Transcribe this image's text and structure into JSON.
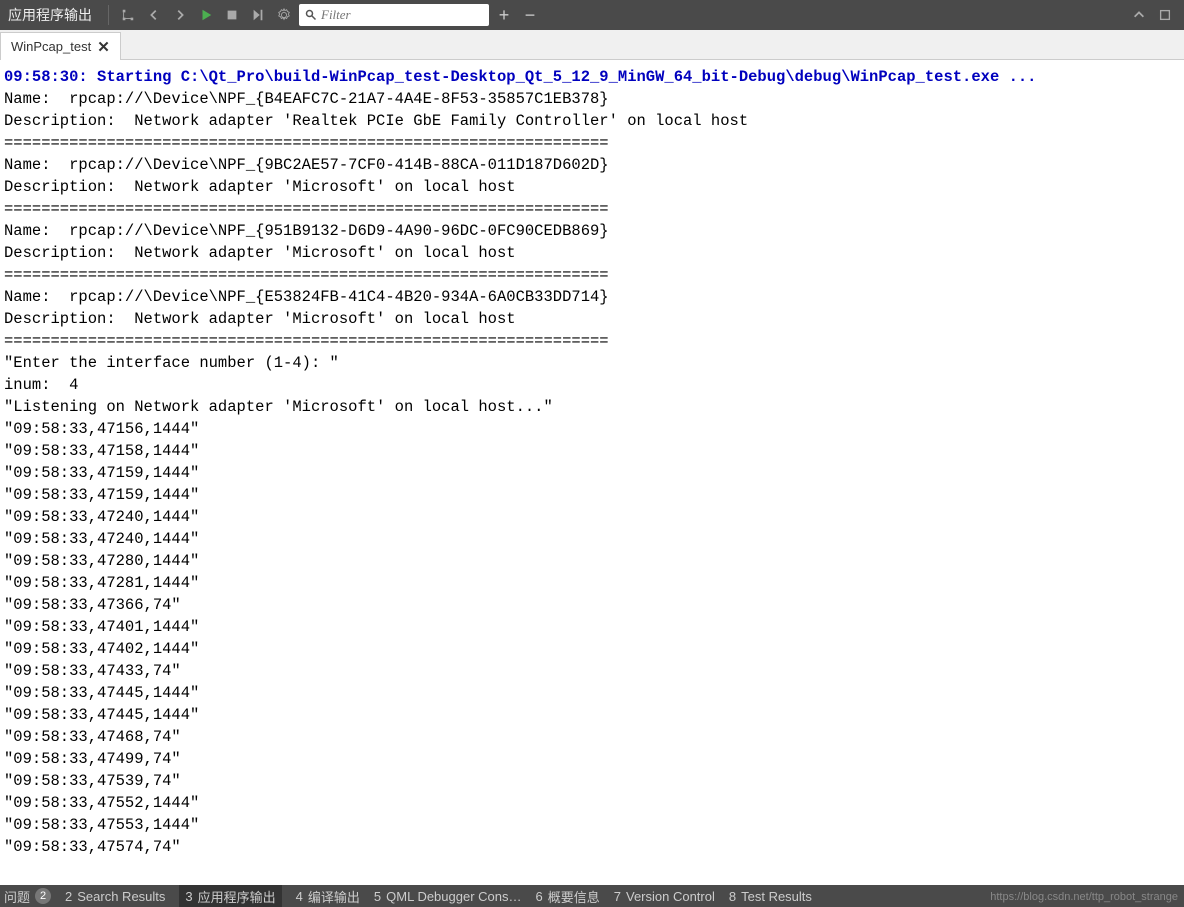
{
  "toolbar": {
    "title": "应用程序输出",
    "filter_placeholder": "Filter"
  },
  "tab": {
    "label": "WinPcap_test"
  },
  "console": {
    "start_line": "09:58:30: Starting C:\\Qt_Pro\\build-WinPcap_test-Desktop_Qt_5_12_9_MinGW_64_bit-Debug\\debug\\WinPcap_test.exe ...",
    "lines": [
      "Name:  rpcap://\\Device\\NPF_{B4EAFC7C-21A7-4A4E-8F53-35857C1EB378}",
      "Description:  Network adapter 'Realtek PCIe GbE Family Controller' on local host",
      "=================================================================",
      "Name:  rpcap://\\Device\\NPF_{9BC2AE57-7CF0-414B-88CA-011D187D602D}",
      "Description:  Network adapter 'Microsoft' on local host",
      "=================================================================",
      "Name:  rpcap://\\Device\\NPF_{951B9132-D6D9-4A90-96DC-0FC90CEDB869}",
      "Description:  Network adapter 'Microsoft' on local host",
      "=================================================================",
      "Name:  rpcap://\\Device\\NPF_{E53824FB-41C4-4B20-934A-6A0CB33DD714}",
      "Description:  Network adapter 'Microsoft' on local host",
      "=================================================================",
      "\"Enter the interface number (1-4): \"",
      "inum:  4",
      "\"Listening on Network adapter 'Microsoft' on local host...\"",
      "\"09:58:33,47156,1444\"",
      "\"09:58:33,47158,1444\"",
      "\"09:58:33,47159,1444\"",
      "\"09:58:33,47159,1444\"",
      "\"09:58:33,47240,1444\"",
      "\"09:58:33,47240,1444\"",
      "\"09:58:33,47280,1444\"",
      "\"09:58:33,47281,1444\"",
      "\"09:58:33,47366,74\"",
      "\"09:58:33,47401,1444\"",
      "\"09:58:33,47402,1444\"",
      "\"09:58:33,47433,74\"",
      "\"09:58:33,47445,1444\"",
      "\"09:58:33,47445,1444\"",
      "\"09:58:33,47468,74\"",
      "\"09:58:33,47499,74\"",
      "\"09:58:33,47539,74\"",
      "\"09:58:33,47552,1444\"",
      "\"09:58:33,47553,1444\"",
      "\"09:58:33,47574,74\""
    ]
  },
  "bottom": {
    "issues_label": "问题",
    "issues_count": "2",
    "items": [
      {
        "num": "2",
        "label": "Search Results"
      },
      {
        "num": "3",
        "label": "应用程序输出",
        "active": true
      },
      {
        "num": "4",
        "label": "编译输出"
      },
      {
        "num": "5",
        "label": "QML Debugger Cons…"
      },
      {
        "num": "6",
        "label": "概要信息"
      },
      {
        "num": "7",
        "label": "Version Control"
      },
      {
        "num": "8",
        "label": "Test Results"
      }
    ]
  },
  "watermark": "https://blog.csdn.net/ttp_robot_strange"
}
